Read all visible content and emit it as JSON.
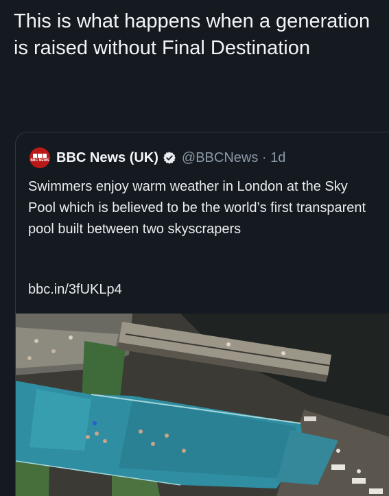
{
  "caption": "This is what happens when a generation is raised without Final Destination",
  "quoted_tweet": {
    "avatar_logo_text": "BBC NEWS",
    "display_name": "BBC News (UK)",
    "handle_time": "@BBCNews · 1d",
    "verified_icon": "verified-badge-icon",
    "text": "Swimmers enjoy warm weather in London at the Sky Pool which is believed to be the world’s first transparent pool built between two skyscrapers",
    "link": "bbc.in/3fUKLp4",
    "photo_icon": "aerial-sky-pool-photo"
  },
  "colors": {
    "background": "#151a21",
    "text": "#e9edf1",
    "secondary_text": "#8b98a5",
    "card_border": "#2e3843",
    "bbc_red": "#bb1919",
    "pool_water": "#2f8ea1"
  }
}
